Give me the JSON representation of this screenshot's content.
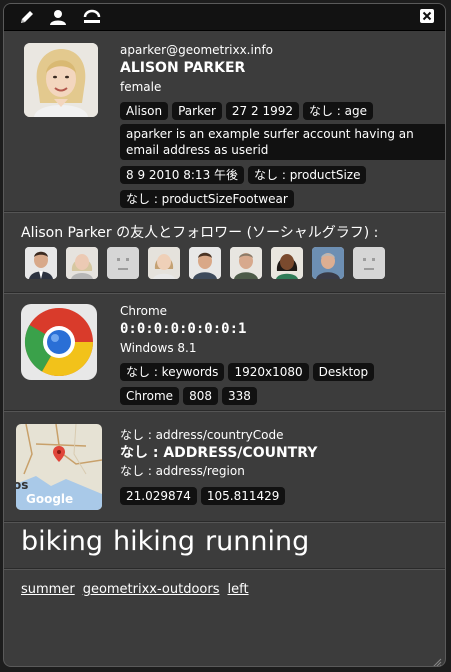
{
  "toolbar": {
    "edit_icon": "pencil-icon",
    "profile_icon": "user-icon",
    "reset_icon": "undo-icon",
    "close_icon": "close-icon"
  },
  "profile": {
    "email": "aparker@geometrixx.info",
    "name": "ALISON PARKER",
    "gender": "female",
    "tags": [
      "Alison",
      "Parker",
      "27 2 1992",
      "なし : age"
    ],
    "about": "aparker is an example surfer account having an email address as userid",
    "tags2": [
      "8 9 2010 8:13 午後",
      "なし : productSize"
    ],
    "tags3": [
      "なし : productSizeFootwear"
    ]
  },
  "social": {
    "title": "Alison Parker の友人とフォロワー (ソーシャルグラフ) :"
  },
  "browser": {
    "name": "Chrome",
    "ip": "0:0:0:0:0:0:0:1",
    "os": "Windows 8.1",
    "tags": [
      "なし : keywords",
      "1920x1080",
      "Desktop",
      "Chrome",
      "808",
      "338"
    ]
  },
  "location": {
    "country_code": "なし : address/countryCode",
    "country": "なし : ADDRESS/COUNTRY",
    "region": "なし : address/region",
    "coords": [
      "21.029874",
      "105.811429"
    ],
    "map_label": "Google",
    "map_fragment": "os"
  },
  "interests": [
    "biking",
    "hiking",
    "running"
  ],
  "links": [
    "summer",
    "geometrixx-outdoors",
    "left"
  ]
}
